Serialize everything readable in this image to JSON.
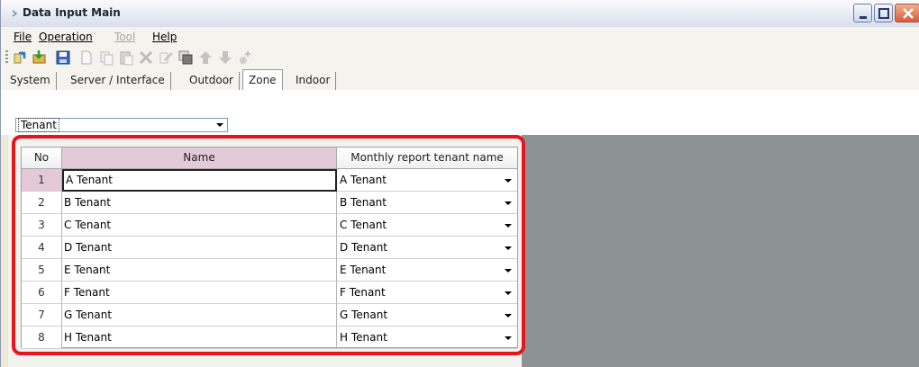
{
  "window": {
    "title": "Data Input Main"
  },
  "menu": [
    {
      "label": "File",
      "enabled": true
    },
    {
      "label": "Operation",
      "enabled": true
    },
    {
      "label": "Tool",
      "enabled": false
    },
    {
      "label": "Help",
      "enabled": true
    }
  ],
  "toolbar": [
    "open-icon",
    "import-icon",
    "save-icon",
    "new-document-icon",
    "copy-icon",
    "paste-icon",
    "delete-icon",
    "edit-icon",
    "properties-icon",
    "move-up-icon",
    "move-down-icon",
    "add-node-icon"
  ],
  "tabs": [
    {
      "label": "System",
      "active": false
    },
    {
      "label": "Server / Interface",
      "active": false
    },
    {
      "label": "Outdoor",
      "active": false
    },
    {
      "label": "Zone",
      "active": true
    },
    {
      "label": "Indoor",
      "active": false
    }
  ],
  "zone_select": {
    "value": "Tenant"
  },
  "grid": {
    "headers": {
      "no": "No",
      "name": "Name",
      "monthly": "Monthly report tenant name"
    },
    "rows": [
      {
        "no": "1",
        "name": "A Tenant",
        "monthly": "A Tenant"
      },
      {
        "no": "2",
        "name": "B Tenant",
        "monthly": "B Tenant"
      },
      {
        "no": "3",
        "name": "C Tenant",
        "monthly": "C Tenant"
      },
      {
        "no": "4",
        "name": "D Tenant",
        "monthly": "D Tenant"
      },
      {
        "no": "5",
        "name": "E Tenant",
        "monthly": "E Tenant"
      },
      {
        "no": "6",
        "name": "F Tenant",
        "monthly": "F Tenant"
      },
      {
        "no": "7",
        "name": "G Tenant",
        "monthly": "G Tenant"
      },
      {
        "no": "8",
        "name": "H Tenant",
        "monthly": "H Tenant"
      }
    ]
  },
  "colors": {
    "highlight": "#e8131b",
    "selected_header": "#e4cad8",
    "work_area_gray": "#8c9394"
  }
}
